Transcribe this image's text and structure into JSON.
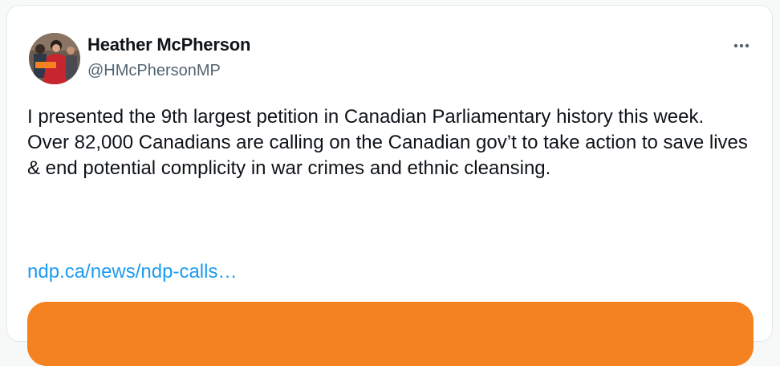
{
  "tweet": {
    "author_name": "Heather McPherson",
    "author_handle": "@HMcPhersonMP",
    "text": "I presented the 9th largest petition in Canadian Parliamentary history this week. Over 82,000 Canadians are calling on the Canadian gov’t to take action to save lives & end potential complicity in war crimes and ethnic cleansing.",
    "link_text": "ndp.ca/news/ndp-calls…",
    "avatar_icon": "profile-photo",
    "more_icon": "more-horizontal-icon"
  },
  "colors": {
    "text_primary": "#0f1419",
    "text_secondary": "#536471",
    "link": "#1d9bf0",
    "preview_card": "#f58220"
  }
}
